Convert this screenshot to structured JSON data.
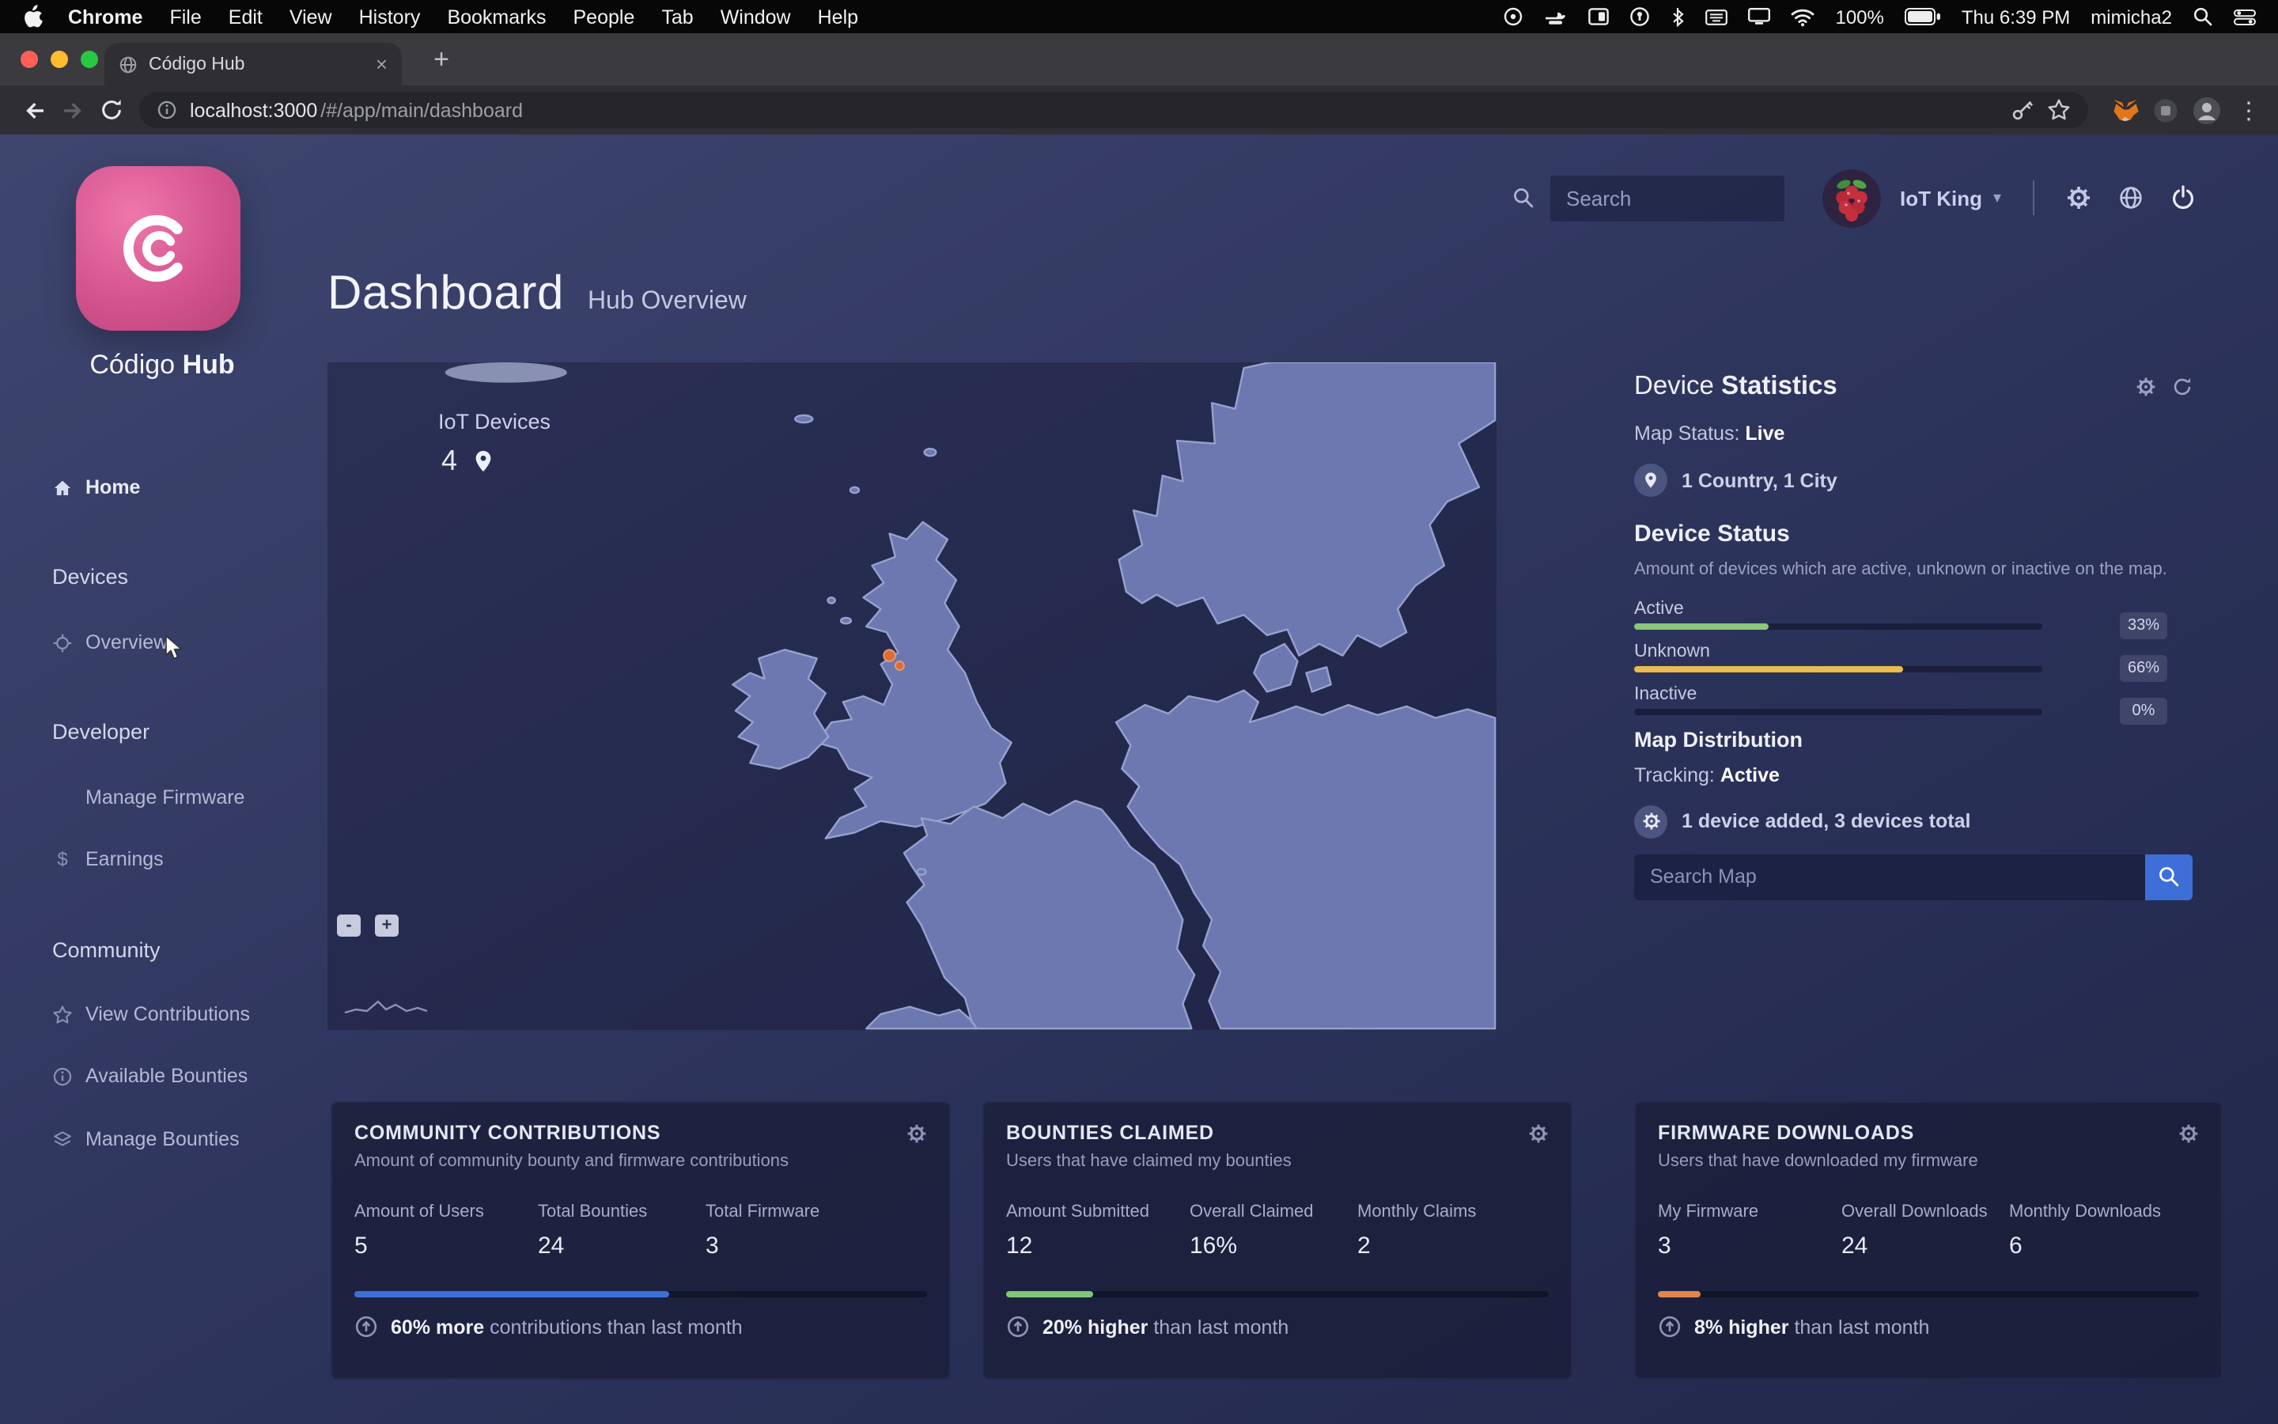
{
  "menubar": {
    "items": [
      "Chrome",
      "File",
      "Edit",
      "View",
      "History",
      "Bookmarks",
      "People",
      "Tab",
      "Window",
      "Help"
    ],
    "battery": "100%",
    "clock": "Thu 6:39 PM",
    "user": "mimicha2"
  },
  "browser": {
    "tab_title": "Código Hub",
    "url_host": "localhost:3000",
    "url_path": "/#/app/main/dashboard"
  },
  "glyphs": {
    "chevron_down": "▾",
    "vertical_dots": "⋮",
    "close_tab": "×",
    "new_tab": "+"
  },
  "sidebar": {
    "brand_regular": "Código",
    "brand_bold": "Hub",
    "home": "Home",
    "section_devices": "Devices",
    "item_overview": "Overview",
    "section_developer": "Developer",
    "item_firmware": "Manage Firmware",
    "item_earnings": "Earnings",
    "earnings_glyph": "$",
    "section_community": "Community",
    "item_contributions": "View Contributions",
    "item_available_bounties": "Available Bounties",
    "item_manage_bounties": "Manage Bounties"
  },
  "topbar": {
    "search_placeholder": "Search",
    "username": "IoT King"
  },
  "header": {
    "title": "Dashboard",
    "subtitle": "Hub Overview"
  },
  "map": {
    "devices_label": "IoT Devices",
    "devices_count": "4",
    "zoom_out": "-",
    "zoom_in": "+"
  },
  "stats": {
    "title_regular": "Device ",
    "title_bold": "Statistics",
    "map_status_label": "Map Status: ",
    "map_status_value": "Live",
    "location": "1 Country, 1 City",
    "status_title": "Device Status",
    "status_desc": "Amount of devices which are active, unknown or inactive on the map.",
    "bars": [
      {
        "label": "Active",
        "pct": 33,
        "badge": "33%",
        "color": "#8bc77b"
      },
      {
        "label": "Unknown",
        "pct": 66,
        "badge": "66%",
        "color": "#e9bc4f"
      },
      {
        "label": "Inactive",
        "pct": 0,
        "badge": "0%",
        "color": "#8bc77b"
      }
    ],
    "distribution_title": "Map Distribution",
    "tracking_label": "Tracking: ",
    "tracking_value": "Active",
    "note": "1 device added, 3 devices total",
    "search_placeholder": "Search Map"
  },
  "cards": [
    {
      "title": "COMMUNITY CONTRIBUTIONS",
      "subtitle": "Amount of community bounty and firmware contributions",
      "stats": [
        {
          "label": "Amount of Users",
          "value": "5"
        },
        {
          "label": "Total Bounties",
          "value": "24"
        },
        {
          "label": "Total Firmware",
          "value": "3"
        }
      ],
      "bar_pct": 55,
      "bar_color": "#3e6fd9",
      "footer_bold": "60% more",
      "footer_rest": " contributions than last month"
    },
    {
      "title": "BOUNTIES CLAIMED",
      "subtitle": "Users that have claimed my bounties",
      "stats": [
        {
          "label": "Amount Submitted",
          "value": "12"
        },
        {
          "label": "Overall Claimed",
          "value": "16%"
        },
        {
          "label": "Monthly Claims",
          "value": "2"
        }
      ],
      "bar_pct": 16,
      "bar_color": "#7ec878",
      "footer_bold": "20% higher",
      "footer_rest": " than last month"
    },
    {
      "title": "FIRMWARE DOWNLOADS",
      "subtitle": "Users that have downloaded my firmware",
      "stats": [
        {
          "label": "My Firmware",
          "value": "3"
        },
        {
          "label": "Overall Downloads",
          "value": "24"
        },
        {
          "label": "Monthly Downloads",
          "value": "6"
        }
      ],
      "bar_pct": 8,
      "bar_color": "#e0854e",
      "footer_bold": "8% higher",
      "footer_rest": " than last month"
    }
  ]
}
